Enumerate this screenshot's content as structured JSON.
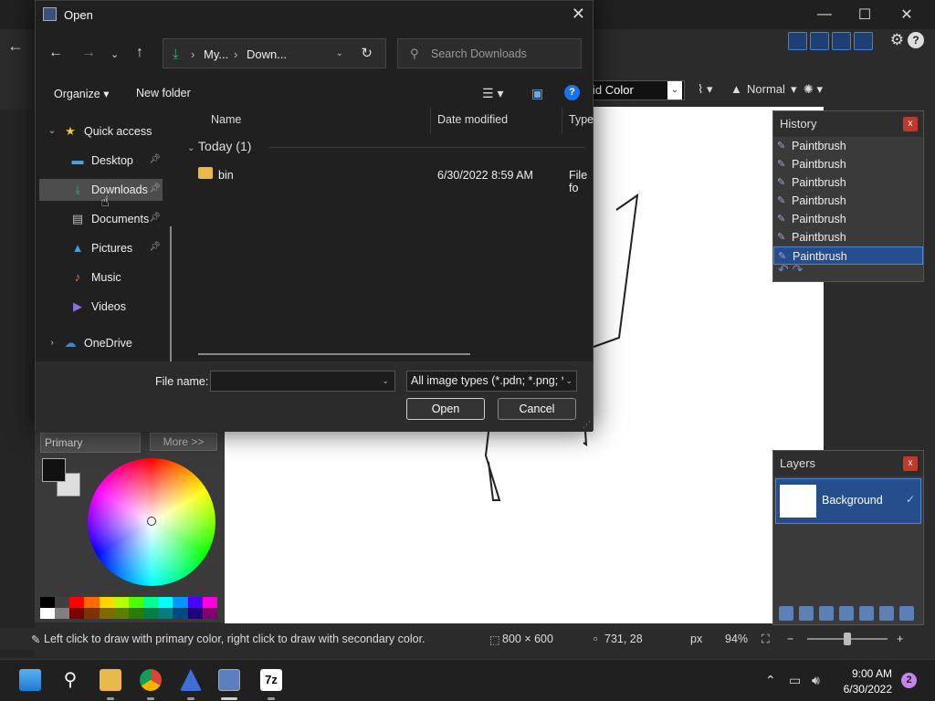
{
  "dialog": {
    "title": "Open",
    "address": {
      "segments": [
        "My...",
        "Down..."
      ]
    },
    "search": {
      "placeholder": "Search Downloads"
    },
    "commandbar": {
      "organize": "Organize",
      "new_folder": "New folder"
    },
    "nav": {
      "quick_access": "Quick access",
      "items": [
        {
          "label": "Desktop",
          "pinned": true
        },
        {
          "label": "Downloads",
          "pinned": true,
          "selected": true
        },
        {
          "label": "Documents",
          "pinned": true
        },
        {
          "label": "Pictures",
          "pinned": true
        },
        {
          "label": "Music",
          "pinned": false
        },
        {
          "label": "Videos",
          "pinned": false
        }
      ],
      "onedrive": "OneDrive"
    },
    "columns": {
      "name": "Name",
      "date_modified": "Date modified",
      "type": "Type"
    },
    "group": "Today (1)",
    "files": [
      {
        "name": "bin",
        "date": "6/30/2022 8:59 AM",
        "type": "File fo"
      }
    ],
    "file_name_label": "File name:",
    "file_name_value": "",
    "filter": "All image types (*.pdn; *.png; *",
    "open_button": "Open",
    "cancel_button": "Cancel"
  },
  "app": {
    "fill_mode": "id Color",
    "blend_mode": "Normal",
    "history": {
      "title": "History",
      "items": [
        "Paintbrush",
        "Paintbrush",
        "Paintbrush",
        "Paintbrush",
        "Paintbrush",
        "Paintbrush",
        "Paintbrush"
      ]
    },
    "layers": {
      "title": "Layers",
      "items": [
        "Background"
      ]
    },
    "colors": {
      "primary_select": "Primary",
      "more_button": "More >>"
    },
    "status": {
      "hint": "Left click to draw with primary color, right click to draw with secondary color.",
      "image_size": "800 × 600",
      "cursor_pos": "731, 28",
      "unit": "px",
      "zoom": "94%"
    },
    "close_glyph": "x"
  },
  "taskbar": {
    "time": "9:00 AM",
    "date": "6/30/2022",
    "notifications": "2",
    "apps": [
      {
        "name": "start",
        "color": "#3a9bdc"
      },
      {
        "name": "search",
        "color": "#ffffff"
      },
      {
        "name": "file-explorer",
        "color": "#e8b84b"
      },
      {
        "name": "chrome",
        "color": "#db4437"
      },
      {
        "name": "paint-net-alt",
        "color": "#3d6fd6"
      },
      {
        "name": "paint-net",
        "color": "#5a7fbf"
      },
      {
        "name": "7zip",
        "color": "#ffffff"
      }
    ]
  },
  "palette": [
    "#000000",
    "#404040",
    "#ff0000",
    "#ff6a00",
    "#ffd800",
    "#b6ff00",
    "#4cff00",
    "#00ff90",
    "#00ffff",
    "#0094ff",
    "#4800ff",
    "#ff00dc",
    "#ffffff",
    "#808080",
    "#7f0000",
    "#7f3300",
    "#7f6a00",
    "#5b7f00",
    "#267f00",
    "#007f46",
    "#007f7f",
    "#004a7f",
    "#21007f",
    "#7f006e"
  ]
}
